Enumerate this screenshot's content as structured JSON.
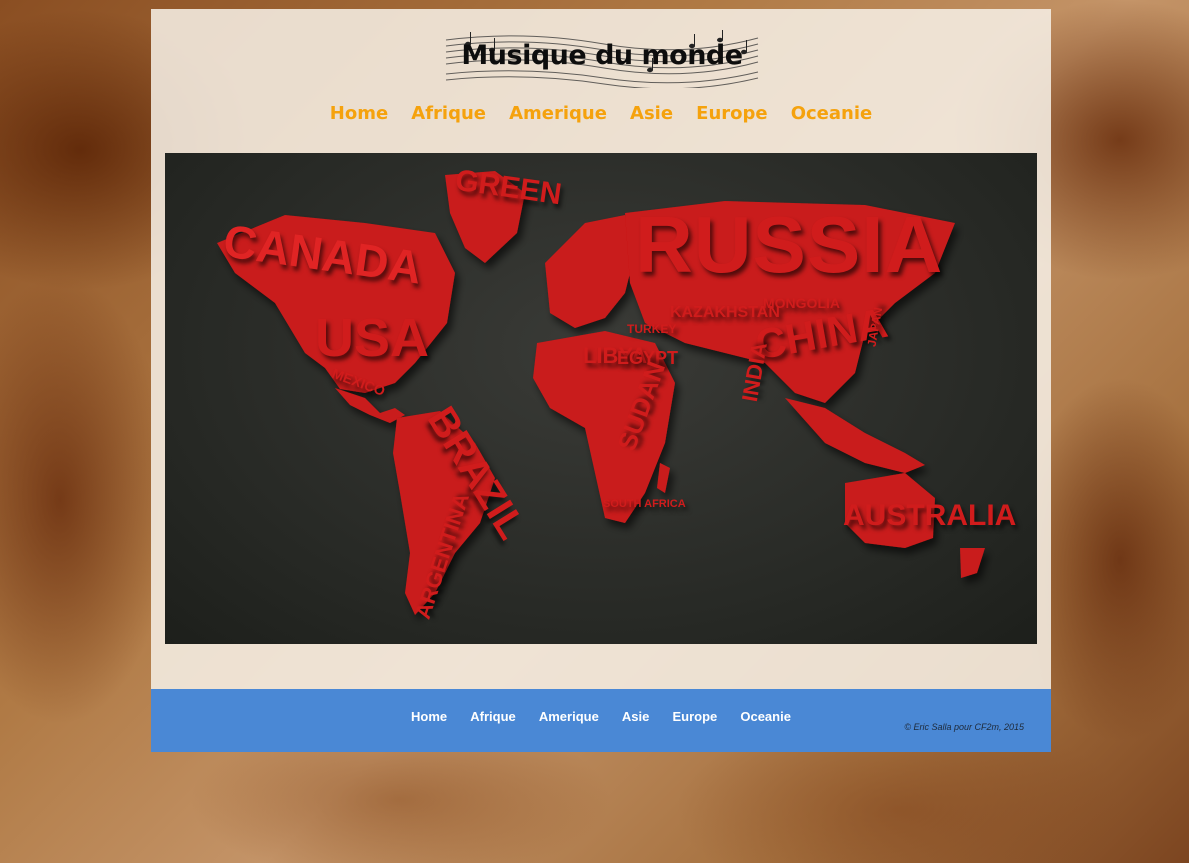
{
  "site": {
    "logo_text": "Musique du monde"
  },
  "nav_top": [
    "Home",
    "Afrique",
    "Amerique",
    "Asie",
    "Europe",
    "Oceanie"
  ],
  "hero": {
    "words": {
      "canada": "CANADA",
      "usa": "USA",
      "greenland": "GREEN",
      "russia": "RUSSIA",
      "china": "CHINA",
      "brazil": "BRAZIL",
      "australia": "AUSTRALIA",
      "argentina": "ARGENTINA",
      "mexico": "MEXICO",
      "libya": "LIBYA",
      "egypt": "EGYPT",
      "sudan": "SUDAN",
      "south_africa": "SOUTH AFRICA",
      "mongolia": "MONGOLIA",
      "kazakhstan": "KAZAKHSTAN",
      "japan": "JAPAN",
      "turkey": "TURKEY",
      "india": "INDIA"
    }
  },
  "nav_bottom": [
    "Home",
    "Afrique",
    "Amerique",
    "Asie",
    "Europe",
    "Oceanie"
  ],
  "footer": {
    "copyright": "© Eric Salla pour CF2m, 2015"
  },
  "colors": {
    "accent_nav": "#f5a20d",
    "footer_bg": "#4a88d5",
    "map_red": "#d01c1c"
  }
}
